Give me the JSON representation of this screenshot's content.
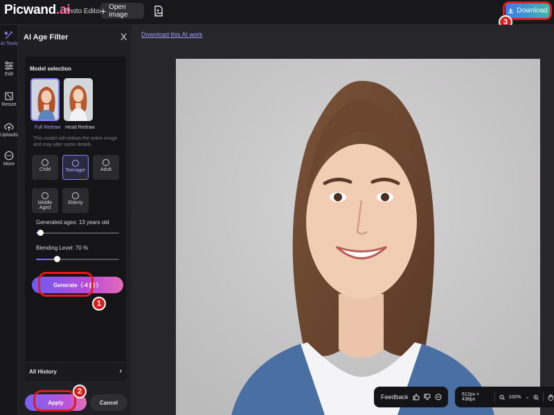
{
  "header": {
    "logo_main": "Picwand",
    "logo_suffix": ".ai",
    "app_title": "Photo Editor",
    "open_image_label": "Open image",
    "download_label": "Download"
  },
  "rail": {
    "items": [
      {
        "label": "AI Tools",
        "icon": "ai-tools-icon"
      },
      {
        "label": "Edit",
        "icon": "sliders-icon"
      },
      {
        "label": "Resize",
        "icon": "resize-icon"
      },
      {
        "label": "Uploads",
        "icon": "upload-cloud-icon"
      },
      {
        "label": "More",
        "icon": "more-icon"
      }
    ]
  },
  "panel": {
    "title": "AI Age Filter",
    "close": "X",
    "model_section_label": "Model selection",
    "models": [
      {
        "label": "Full Redraw",
        "selected": true
      },
      {
        "label": "Head Redraw",
        "selected": false
      }
    ],
    "model_description": "This model will redraw the entire image and may alter some details.",
    "ages": [
      {
        "label": "Child",
        "selected": false
      },
      {
        "label": "Teenager",
        "selected": true
      },
      {
        "label": "Adult",
        "selected": false
      },
      {
        "label": "Middle Aged",
        "selected": false
      },
      {
        "label": "Elderly",
        "selected": false
      }
    ],
    "generated_ages_label": "Generated ages: 13 years old",
    "generated_ages_value": 0.05,
    "blending_label": "Blending Level: 70 %",
    "blending_value": 0.25,
    "generate_label": "Generate（-4",
    "generate_suffix": "）",
    "history_label": "All History",
    "history_chevron": "›",
    "apply_label": "Apply",
    "cancel_label": "Cancel"
  },
  "workspace": {
    "download_link": "Download this AI work",
    "feedback_label": "Feedback",
    "image_size": "612px × 438px",
    "zoom": "100%"
  },
  "annotations": {
    "step1": "1",
    "step2": "2",
    "step3": "3"
  },
  "colors": {
    "accent": "#8a7dff",
    "annotation_red": "#e21b1b",
    "download_gradient": [
      "#3d7bf0",
      "#3fb7a8"
    ]
  }
}
